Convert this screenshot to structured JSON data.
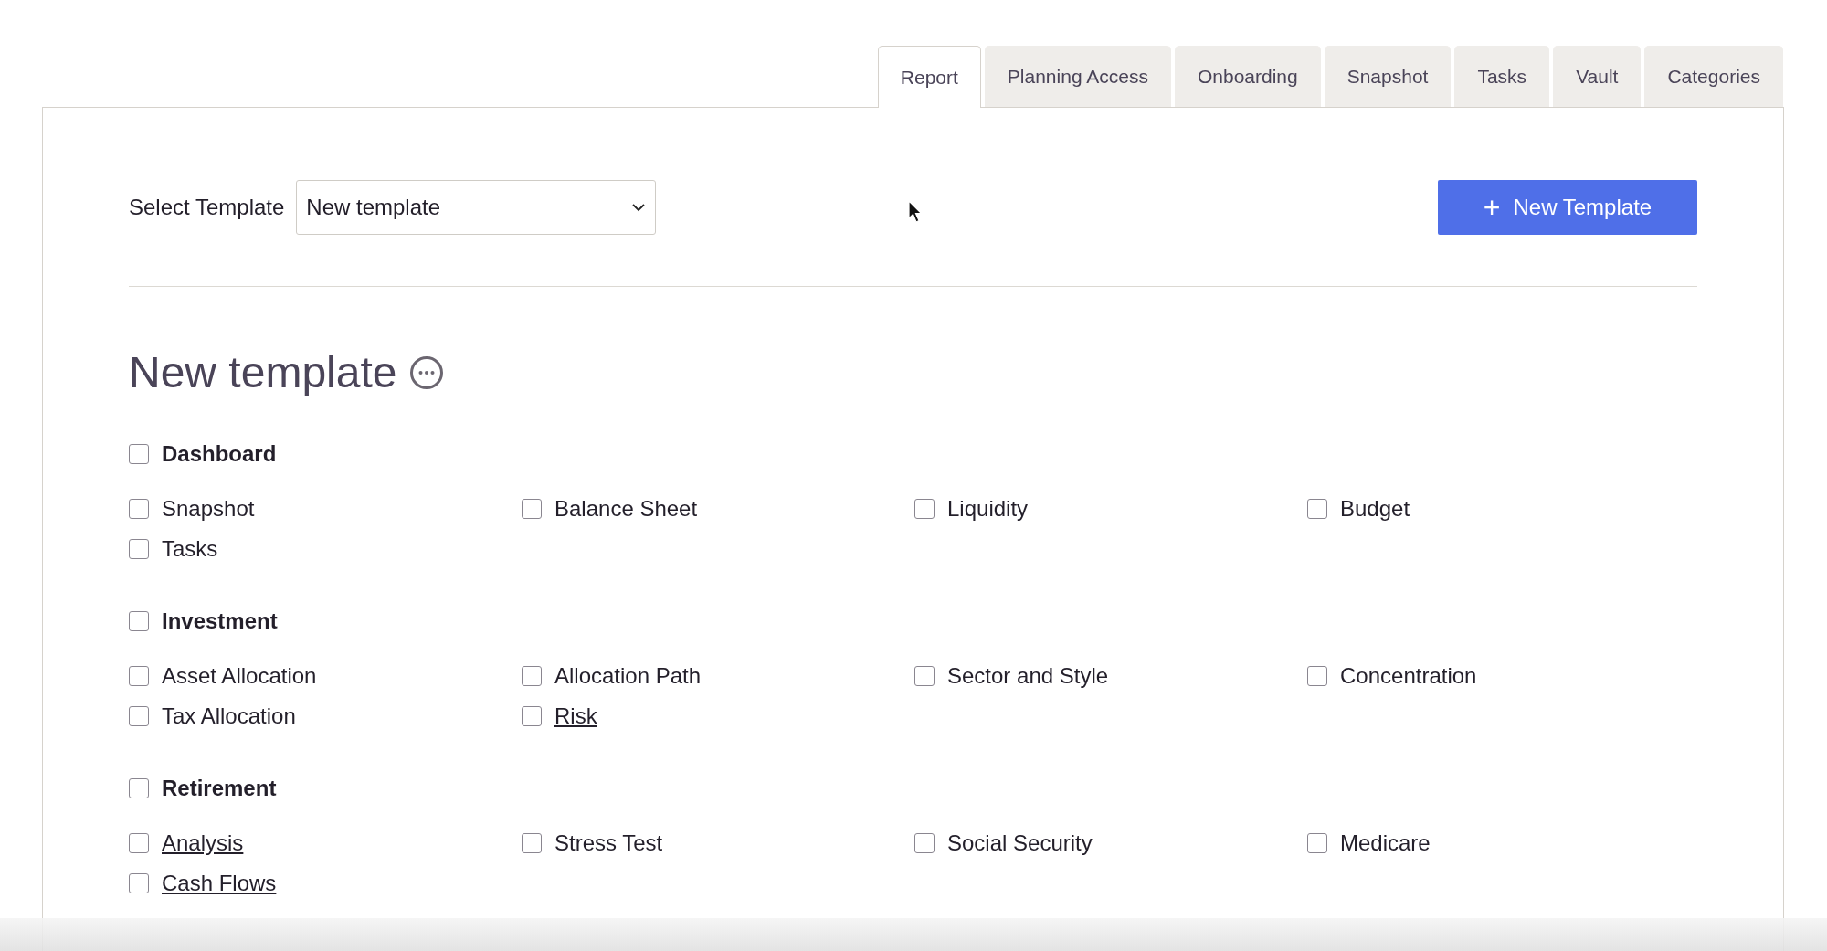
{
  "tabs": [
    {
      "label": "Report",
      "selected": true
    },
    {
      "label": "Planning Access",
      "selected": false
    },
    {
      "label": "Onboarding",
      "selected": false
    },
    {
      "label": "Snapshot",
      "selected": false
    },
    {
      "label": "Tasks",
      "selected": false
    },
    {
      "label": "Vault",
      "selected": false
    },
    {
      "label": "Categories",
      "selected": false
    }
  ],
  "template_select": {
    "label": "Select Template",
    "value": "New template"
  },
  "new_template_button": {
    "icon": "+",
    "label": "New Template"
  },
  "heading": "New template",
  "sections": [
    {
      "title": "Dashboard",
      "checked": false,
      "items": [
        {
          "label": "Snapshot",
          "checked": false,
          "kind": "plain"
        },
        {
          "label": "Balance Sheet",
          "checked": false,
          "kind": "plain"
        },
        {
          "label": "Liquidity",
          "checked": false,
          "kind": "plain"
        },
        {
          "label": "Budget",
          "checked": false,
          "kind": "plain"
        },
        {
          "label": "Tasks",
          "checked": false,
          "kind": "plain"
        }
      ]
    },
    {
      "title": "Investment",
      "checked": false,
      "items": [
        {
          "label": "Asset Allocation",
          "checked": false,
          "kind": "plain"
        },
        {
          "label": "Allocation Path",
          "checked": false,
          "kind": "plain"
        },
        {
          "label": "Sector and Style",
          "checked": false,
          "kind": "plain"
        },
        {
          "label": "Concentration",
          "checked": false,
          "kind": "plain"
        },
        {
          "label": "Tax Allocation",
          "checked": false,
          "kind": "plain"
        },
        {
          "label": "Risk",
          "checked": false,
          "kind": "link"
        }
      ]
    },
    {
      "title": "Retirement",
      "checked": false,
      "items": [
        {
          "label": "Analysis",
          "checked": false,
          "kind": "link"
        },
        {
          "label": "Stress Test",
          "checked": false,
          "kind": "plain"
        },
        {
          "label": "Social Security",
          "checked": false,
          "kind": "plain"
        },
        {
          "label": "Medicare",
          "checked": false,
          "kind": "plain"
        },
        {
          "label": "Cash Flows",
          "checked": false,
          "kind": "link"
        }
      ]
    }
  ]
}
